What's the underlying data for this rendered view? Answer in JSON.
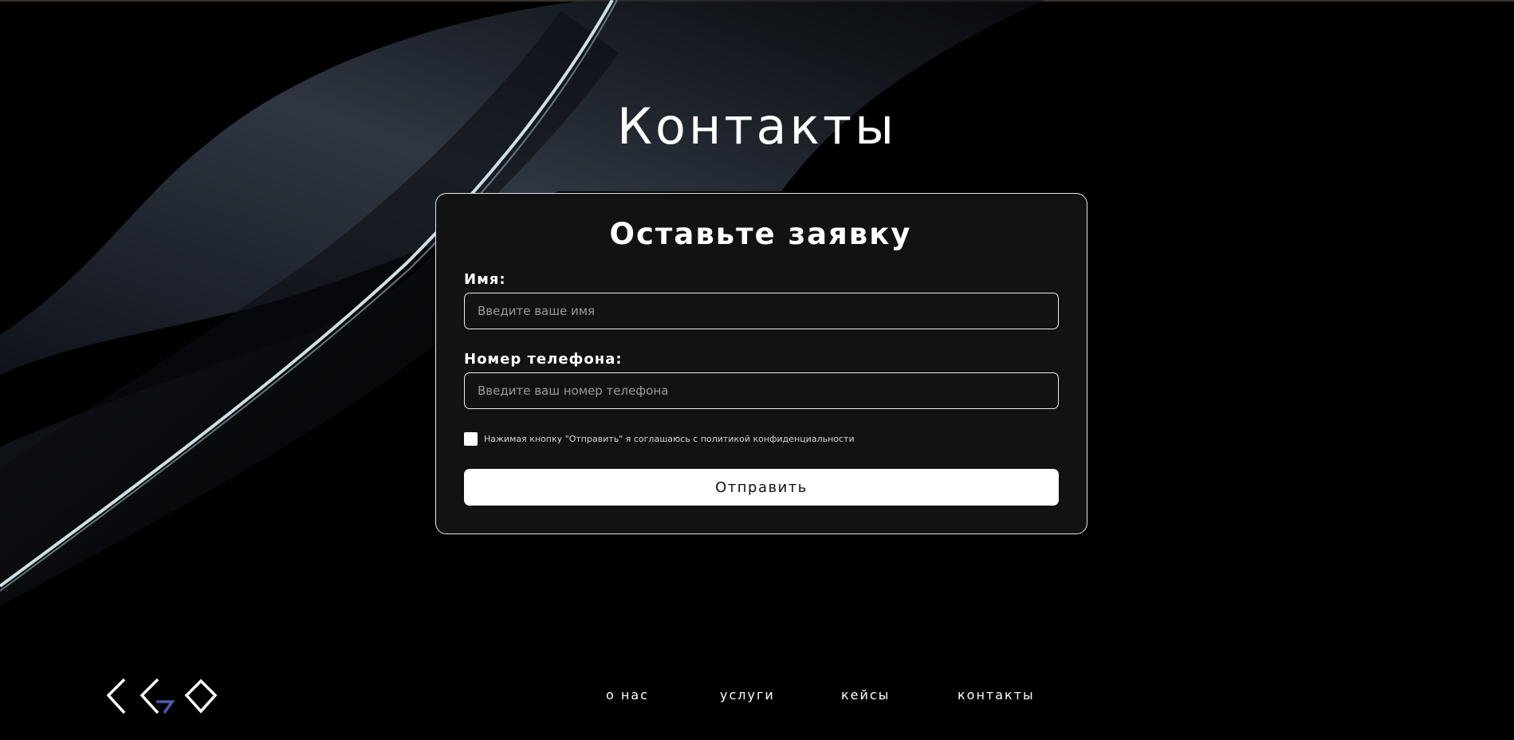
{
  "page": {
    "title": "Контакты"
  },
  "form": {
    "heading": "Оставьте заявку",
    "name_label": "Имя:",
    "name_placeholder": "Введите ваше имя",
    "name_value": "",
    "phone_label": "Номер телефона:",
    "phone_placeholder": "Введите ваш номер телефона",
    "phone_value": "",
    "consent_text": "Нажимая кнопку \"Отправить\" я соглашаюсь с политикой конфиденциальности",
    "consent_checked": false,
    "submit_label": "Отправить"
  },
  "footer": {
    "logo_icon": "logo-diamonds-icon",
    "nav": [
      {
        "label": "о нас"
      },
      {
        "label": "услуги"
      },
      {
        "label": "кейсы"
      },
      {
        "label": "контакты"
      }
    ]
  },
  "colors": {
    "background": "#000000",
    "card": "#121212",
    "text": "#ffffff",
    "logo_accent": "#4a5fa8"
  }
}
